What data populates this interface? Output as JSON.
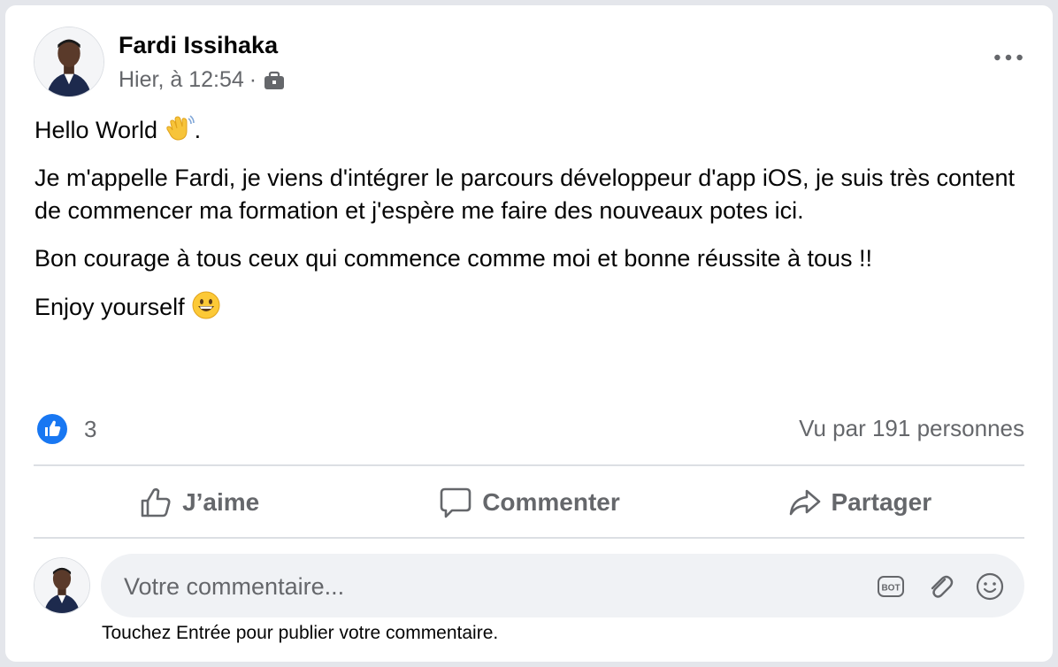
{
  "post": {
    "author": "Fardi Issihaka",
    "timestamp": "Hier, à 12:54",
    "separator": "·",
    "audience_icon": "briefcase-icon",
    "menu_icon": "more-dots-icon",
    "body": {
      "line1": "Hello World",
      "line1_suffix": ".",
      "line1_emoji": "waving-hand-emoji",
      "paragraph2": "Je m'appelle Fardi, je viens d'intégrer le parcours développeur d'app iOS, je suis très content de commencer ma formation et j'espère me faire des nouveaux potes ici.",
      "paragraph3": "Bon courage à tous ceux qui commence comme moi et bonne réussite à tous !!",
      "paragraph4": "Enjoy yourself",
      "paragraph4_emoji": "grinning-face-emoji"
    }
  },
  "stats": {
    "like_count": "3",
    "seen_by": "Vu par 191 personnes"
  },
  "actions": {
    "like": "J’aime",
    "comment": "Commenter",
    "share": "Partager"
  },
  "composer": {
    "placeholder": "Votre commentaire...",
    "hint": "Touchez Entrée pour publier votre commentaire.",
    "tools": [
      "bot-icon",
      "attachment-icon",
      "emoji-icon"
    ]
  },
  "colors": {
    "accent": "#1877f2",
    "secondary_text": "#65676b",
    "divider": "#dcdfe4",
    "input_bg": "#f0f2f5"
  }
}
